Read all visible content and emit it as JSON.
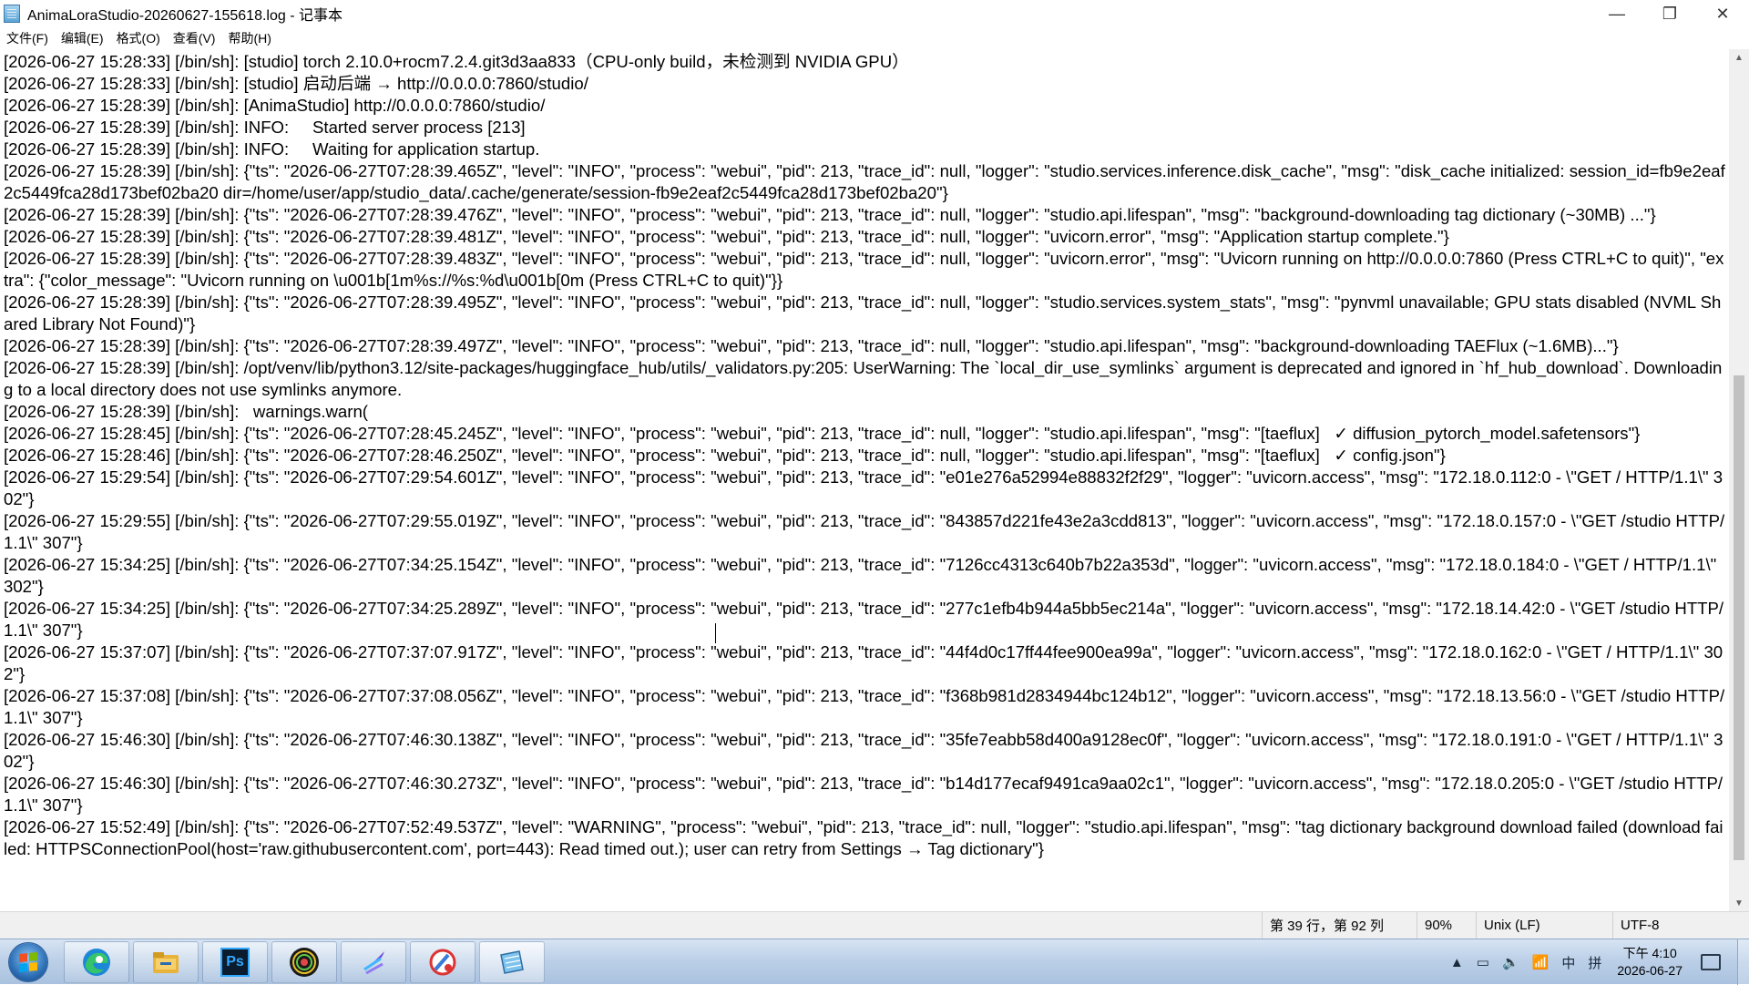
{
  "window": {
    "title": "AnimaLoraStudio-20260627-155618.log - 记事本",
    "minimize_glyph": "—",
    "maximize_glyph": "❐",
    "close_glyph": "✕"
  },
  "menu": [
    "文件(F)",
    "编辑(E)",
    "格式(O)",
    "查看(V)",
    "帮助(H)"
  ],
  "log_lines": [
    "[2026-06-27 15:28:33] [/bin/sh]: [studio] torch 2.10.0+rocm7.2.4.git3d3aa833（CPU-only build，未检测到 NVIDIA GPU）",
    "[2026-06-27 15:28:33] [/bin/sh]: [studio] 启动后端 → http://0.0.0.0:7860/studio/",
    "[2026-06-27 15:28:39] [/bin/sh]: [AnimaStudio] http://0.0.0.0:7860/studio/",
    "[2026-06-27 15:28:39] [/bin/sh]: INFO:     Started server process [213]",
    "[2026-06-27 15:28:39] [/bin/sh]: INFO:     Waiting for application startup.",
    "[2026-06-27 15:28:39] [/bin/sh]: {\"ts\": \"2026-06-27T07:28:39.465Z\", \"level\": \"INFO\", \"process\": \"webui\", \"pid\": 213, \"trace_id\": null, \"logger\": \"studio.services.inference.disk_cache\", \"msg\": \"disk_cache initialized: session_id=fb9e2eaf2c5449fca28d173bef02ba20 dir=/home/user/app/studio_data/.cache/generate/session-fb9e2eaf2c5449fca28d173bef02ba20\"}",
    "[2026-06-27 15:28:39] [/bin/sh]: {\"ts\": \"2026-06-27T07:28:39.476Z\", \"level\": \"INFO\", \"process\": \"webui\", \"pid\": 213, \"trace_id\": null, \"logger\": \"studio.api.lifespan\", \"msg\": \"background-downloading tag dictionary (~30MB) ...\"}",
    "[2026-06-27 15:28:39] [/bin/sh]: {\"ts\": \"2026-06-27T07:28:39.481Z\", \"level\": \"INFO\", \"process\": \"webui\", \"pid\": 213, \"trace_id\": null, \"logger\": \"uvicorn.error\", \"msg\": \"Application startup complete.\"}",
    "[2026-06-27 15:28:39] [/bin/sh]: {\"ts\": \"2026-06-27T07:28:39.483Z\", \"level\": \"INFO\", \"process\": \"webui\", \"pid\": 213, \"trace_id\": null, \"logger\": \"uvicorn.error\", \"msg\": \"Uvicorn running on http://0.0.0.0:7860 (Press CTRL+C to quit)\", \"extra\": {\"color_message\": \"Uvicorn running on \\u001b[1m%s://%s:%d\\u001b[0m (Press CTRL+C to quit)\"}}",
    "[2026-06-27 15:28:39] [/bin/sh]: {\"ts\": \"2026-06-27T07:28:39.495Z\", \"level\": \"INFO\", \"process\": \"webui\", \"pid\": 213, \"trace_id\": null, \"logger\": \"studio.services.system_stats\", \"msg\": \"pynvml unavailable; GPU stats disabled (NVML Shared Library Not Found)\"}",
    "[2026-06-27 15:28:39] [/bin/sh]: {\"ts\": \"2026-06-27T07:28:39.497Z\", \"level\": \"INFO\", \"process\": \"webui\", \"pid\": 213, \"trace_id\": null, \"logger\": \"studio.api.lifespan\", \"msg\": \"background-downloading TAEFlux (~1.6MB)...\"}",
    "[2026-06-27 15:28:39] [/bin/sh]: /opt/venv/lib/python3.12/site-packages/huggingface_hub/utils/_validators.py:205: UserWarning: The `local_dir_use_symlinks` argument is deprecated and ignored in `hf_hub_download`. Downloading to a local directory does not use symlinks anymore.",
    "[2026-06-27 15:28:39] [/bin/sh]:   warnings.warn(",
    "[2026-06-27 15:28:45] [/bin/sh]: {\"ts\": \"2026-06-27T07:28:45.245Z\", \"level\": \"INFO\", \"process\": \"webui\", \"pid\": 213, \"trace_id\": null, \"logger\": \"studio.api.lifespan\", \"msg\": \"[taeflux]   ✓ diffusion_pytorch_model.safetensors\"}",
    "[2026-06-27 15:28:46] [/bin/sh]: {\"ts\": \"2026-06-27T07:28:46.250Z\", \"level\": \"INFO\", \"process\": \"webui\", \"pid\": 213, \"trace_id\": null, \"logger\": \"studio.api.lifespan\", \"msg\": \"[taeflux]   ✓ config.json\"}",
    "[2026-06-27 15:29:54] [/bin/sh]: {\"ts\": \"2026-06-27T07:29:54.601Z\", \"level\": \"INFO\", \"process\": \"webui\", \"pid\": 213, \"trace_id\": \"e01e276a52994e88832f2f29\", \"logger\": \"uvicorn.access\", \"msg\": \"172.18.0.112:0 - \\\"GET / HTTP/1.1\\\" 302\"}",
    "[2026-06-27 15:29:55] [/bin/sh]: {\"ts\": \"2026-06-27T07:29:55.019Z\", \"level\": \"INFO\", \"process\": \"webui\", \"pid\": 213, \"trace_id\": \"843857d221fe43e2a3cdd813\", \"logger\": \"uvicorn.access\", \"msg\": \"172.18.0.157:0 - \\\"GET /studio HTTP/1.1\\\" 307\"}",
    "[2026-06-27 15:34:25] [/bin/sh]: {\"ts\": \"2026-06-27T07:34:25.154Z\", \"level\": \"INFO\", \"process\": \"webui\", \"pid\": 213, \"trace_id\": \"7126cc4313c640b7b22a353d\", \"logger\": \"uvicorn.access\", \"msg\": \"172.18.0.184:0 - \\\"GET / HTTP/1.1\\\" 302\"}",
    "[2026-06-27 15:34:25] [/bin/sh]: {\"ts\": \"2026-06-27T07:34:25.289Z\", \"level\": \"INFO\", \"process\": \"webui\", \"pid\": 213, \"trace_id\": \"277c1efb4b944a5bb5ec214a\", \"logger\": \"uvicorn.access\", \"msg\": \"172.18.14.42:0 - \\\"GET /studio HTTP/1.1\\\" 307\"}",
    "[2026-06-27 15:37:07] [/bin/sh]: {\"ts\": \"2026-06-27T07:37:07.917Z\", \"level\": \"INFO\", \"process\": \"webui\", \"pid\": 213, \"trace_id\": \"44f4d0c17ff44fee900ea99a\", \"logger\": \"uvicorn.access\", \"msg\": \"172.18.0.162:0 - \\\"GET / HTTP/1.1\\\" 302\"}",
    "[2026-06-27 15:37:08] [/bin/sh]: {\"ts\": \"2026-06-27T07:37:08.056Z\", \"level\": \"INFO\", \"process\": \"webui\", \"pid\": 213, \"trace_id\": \"f368b981d2834944bc124b12\", \"logger\": \"uvicorn.access\", \"msg\": \"172.18.13.56:0 - \\\"GET /studio HTTP/1.1\\\" 307\"}",
    "[2026-06-27 15:46:30] [/bin/sh]: {\"ts\": \"2026-06-27T07:46:30.138Z\", \"level\": \"INFO\", \"process\": \"webui\", \"pid\": 213, \"trace_id\": \"35fe7eabb58d400a9128ec0f\", \"logger\": \"uvicorn.access\", \"msg\": \"172.18.0.191:0 - \\\"GET / HTTP/1.1\\\" 302\"}",
    "[2026-06-27 15:46:30] [/bin/sh]: {\"ts\": \"2026-06-27T07:46:30.273Z\", \"level\": \"INFO\", \"process\": \"webui\", \"pid\": 213, \"trace_id\": \"b14d177ecaf9491ca9aa02c1\", \"logger\": \"uvicorn.access\", \"msg\": \"172.18.0.205:0 - \\\"GET /studio HTTP/1.1\\\" 307\"}",
    "[2026-06-27 15:52:49] [/bin/sh]: {\"ts\": \"2026-06-27T07:52:49.537Z\", \"level\": \"WARNING\", \"process\": \"webui\", \"pid\": 213, \"trace_id\": null, \"logger\": \"studio.api.lifespan\", \"msg\": \"tag dictionary background download failed (download failed: HTTPSConnectionPool(host='raw.githubusercontent.com', port=443): Read timed out.); user can retry from Settings → Tag dictionary\"}"
  ],
  "status": {
    "position": "第 39 行，第 92 列",
    "zoom": "90%",
    "line_ending": "Unix (LF)",
    "encoding": "UTF-8"
  },
  "taskbar": {
    "apps": [
      {
        "name": "edge-icon"
      },
      {
        "name": "file-explorer-icon"
      },
      {
        "name": "photoshop-icon",
        "label": "Ps"
      },
      {
        "name": "radial-target-app-icon"
      },
      {
        "name": "feather-app-icon"
      },
      {
        "name": "paint-tools-app-icon"
      },
      {
        "name": "notepad-icon"
      }
    ],
    "tray": {
      "ime_lang": "中",
      "ime_mode": "拼",
      "time": "下午 4:10",
      "date": "2026-06-27"
    }
  },
  "colors": {
    "taskbar_top": "#d7e4f3",
    "taskbar_bottom": "#aac2df",
    "statusbar": "#f0f0f0",
    "scroll_thumb": "#c1c1c1"
  }
}
